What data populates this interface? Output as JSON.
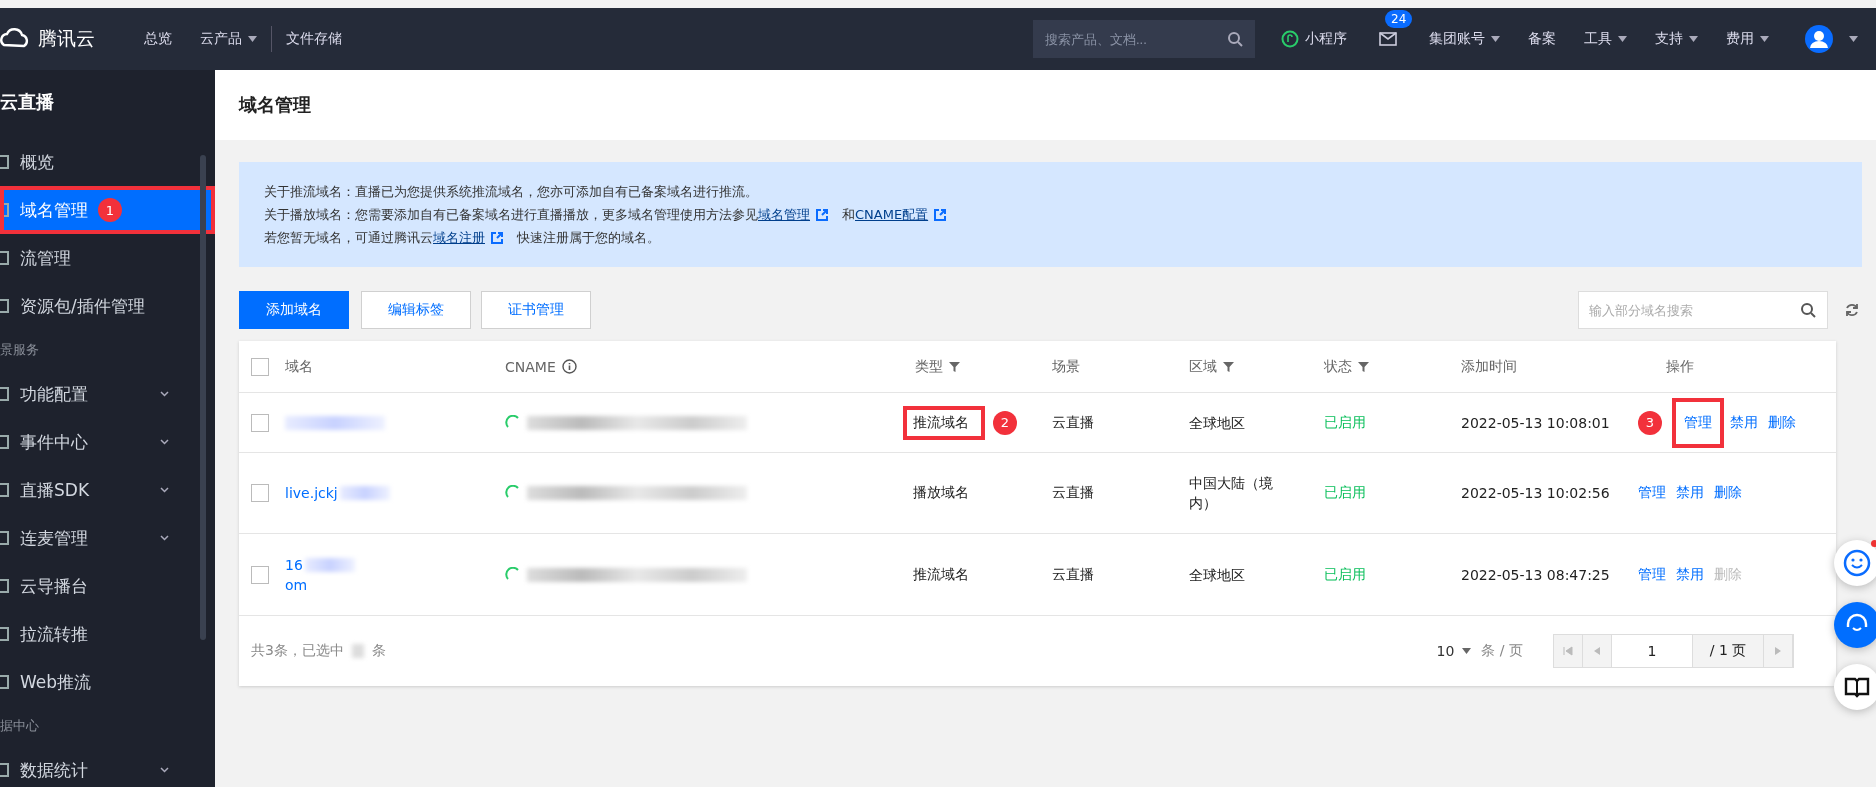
{
  "topbar": {
    "logo": "腾讯云",
    "nav": [
      {
        "label": "总览",
        "dropdown": false
      },
      {
        "label": "云产品",
        "dropdown": true
      },
      {
        "label": "文件存储",
        "dropdown": false
      }
    ],
    "search": {
      "placeholder": "搜索产品、文档..."
    },
    "mini_program": "小程序",
    "mail_badge": "24",
    "menus": [
      {
        "label": "集团账号",
        "dropdown": true
      },
      {
        "label": "备案",
        "dropdown": false
      },
      {
        "label": "工具",
        "dropdown": true
      },
      {
        "label": "支持",
        "dropdown": true
      },
      {
        "label": "费用",
        "dropdown": true
      }
    ]
  },
  "sidebar": {
    "title": "云直播",
    "items": [
      {
        "kind": "item",
        "label": "概览",
        "selected": false,
        "expandable": false
      },
      {
        "kind": "item",
        "label": "域名管理",
        "selected": true,
        "expandable": false,
        "marker": "1"
      },
      {
        "kind": "item",
        "label": "流管理",
        "selected": false,
        "expandable": false
      },
      {
        "kind": "item",
        "label": "资源包/插件管理",
        "selected": false,
        "expandable": false
      },
      {
        "kind": "section",
        "label": "景服务"
      },
      {
        "kind": "item",
        "label": "功能配置",
        "selected": false,
        "expandable": true
      },
      {
        "kind": "item",
        "label": "事件中心",
        "selected": false,
        "expandable": true
      },
      {
        "kind": "item",
        "label": "直播SDK",
        "selected": false,
        "expandable": true
      },
      {
        "kind": "item",
        "label": "连麦管理",
        "selected": false,
        "expandable": true
      },
      {
        "kind": "item",
        "label": "云导播台",
        "selected": false,
        "expandable": false
      },
      {
        "kind": "item",
        "label": "拉流转推",
        "selected": false,
        "expandable": false
      },
      {
        "kind": "item",
        "label": "Web推流",
        "selected": false,
        "expandable": false
      },
      {
        "kind": "section",
        "label": "据中心"
      },
      {
        "kind": "item",
        "label": "数据统计",
        "selected": false,
        "expandable": true
      }
    ]
  },
  "page_title": "域名管理",
  "notice": [
    {
      "parts": [
        {
          "kind": "text",
          "text": "关于推流域名：直播已为您提供系统推流域名，您亦可添加自有已备案域名进行推流。"
        }
      ]
    },
    {
      "parts": [
        {
          "kind": "text",
          "text": "关于播放域名：您需要添加自有已备案域名进行直播播放，更多域名管理使用方法参见"
        },
        {
          "kind": "link",
          "text": "域名管理"
        },
        {
          "kind": "text",
          "text": "和"
        },
        {
          "kind": "link",
          "text": "CNAME配置"
        }
      ]
    },
    {
      "parts": [
        {
          "kind": "text",
          "text": "若您暂无域名，可通过腾讯云"
        },
        {
          "kind": "link",
          "text": "域名注册"
        },
        {
          "kind": "text",
          "text": "快速注册属于您的域名。"
        }
      ]
    }
  ],
  "toolbar": {
    "buttons": [
      {
        "label": "添加域名",
        "primary": true
      },
      {
        "label": "编辑标签",
        "primary": false
      },
      {
        "label": "证书管理",
        "primary": false
      }
    ],
    "search": {
      "placeholder": "输入部分域名搜索"
    }
  },
  "table": {
    "header_checked": false,
    "columns": [
      {
        "label": "域名",
        "filter": false,
        "info": false
      },
      {
        "label": "CNAME",
        "filter": false,
        "info": true
      },
      {
        "label": "类型",
        "filter": true,
        "info": false
      },
      {
        "label": "场景",
        "filter": false,
        "info": false
      },
      {
        "label": "区域",
        "filter": true,
        "info": false
      },
      {
        "label": "状态",
        "filter": true,
        "info": false
      },
      {
        "label": "添加时间",
        "filter": false,
        "info": false
      },
      {
        "label": "操作",
        "filter": false,
        "info": false
      }
    ],
    "rows": [
      {
        "checked": false,
        "domain": [],
        "type": "推流域名",
        "type_marker": "2",
        "scene": "云直播",
        "region": "全球地区",
        "status": "已启用",
        "time": "2022-05-13 10:08:01",
        "actions": [
          {
            "label": "管理",
            "disabled": false,
            "marker": "3"
          },
          {
            "label": "禁用",
            "disabled": false
          },
          {
            "label": "删除",
            "disabled": false
          }
        ]
      },
      {
        "checked": false,
        "domain": [
          "live.jckj"
        ],
        "type": "播放域名",
        "scene": "云直播",
        "region": "中国大陆（境内）",
        "status": "已启用",
        "time": "2022-05-13 10:02:56",
        "actions": [
          {
            "label": "管理",
            "disabled": false
          },
          {
            "label": "禁用",
            "disabled": false
          },
          {
            "label": "删除",
            "disabled": false
          }
        ]
      },
      {
        "checked": false,
        "domain": [
          "16",
          "om"
        ],
        "type": "推流域名",
        "scene": "云直播",
        "region": "全球地区",
        "status": "已启用",
        "time": "2022-05-13 08:47:25",
        "actions": [
          {
            "label": "管理",
            "disabled": false
          },
          {
            "label": "禁用",
            "disabled": false
          },
          {
            "label": "删除",
            "disabled": true
          }
        ]
      }
    ]
  },
  "footer": {
    "total": "共3条，已选中",
    "unit": "条",
    "page_size": "10",
    "page_size_unit": "条 / 页",
    "page": "1",
    "pages": "/ 1 页"
  }
}
